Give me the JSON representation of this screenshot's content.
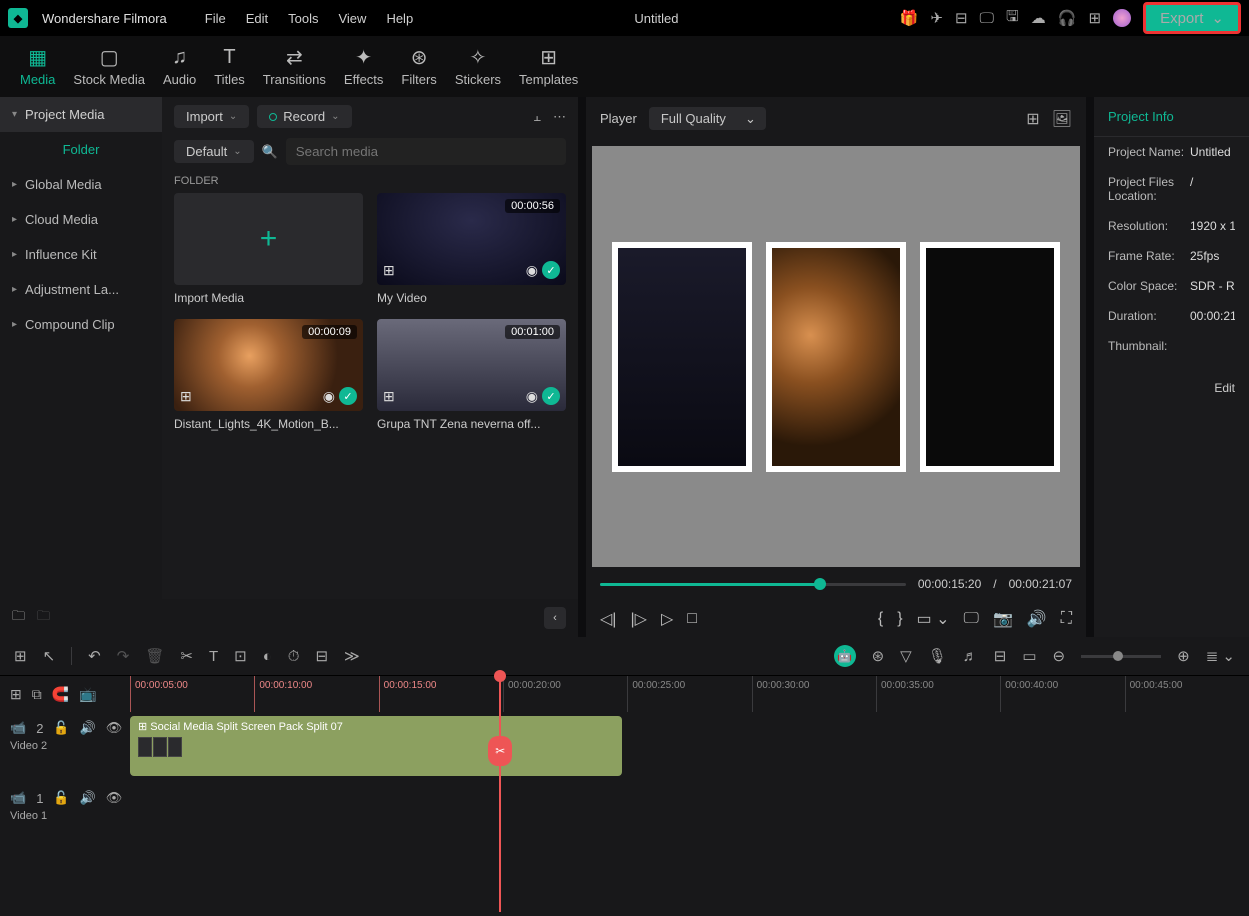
{
  "app": {
    "name": "Wondershare Filmora",
    "doc": "Untitled"
  },
  "menu": [
    "File",
    "Edit",
    "Tools",
    "View",
    "Help"
  ],
  "export": "Export",
  "topTabs": [
    {
      "label": "Media",
      "icon": "▦"
    },
    {
      "label": "Stock Media",
      "icon": "▢"
    },
    {
      "label": "Audio",
      "icon": "♫"
    },
    {
      "label": "Titles",
      "icon": "T"
    },
    {
      "label": "Transitions",
      "icon": "⇄"
    },
    {
      "label": "Effects",
      "icon": "✦"
    },
    {
      "label": "Filters",
      "icon": "⊛"
    },
    {
      "label": "Stickers",
      "icon": "✧"
    },
    {
      "label": "Templates",
      "icon": "⊞"
    }
  ],
  "sideNav": {
    "header": "Project Media",
    "folder": "Folder",
    "items": [
      "Global Media",
      "Cloud Media",
      "Influence Kit",
      "Adjustment La...",
      "Compound Clip"
    ]
  },
  "mediaToolbar": {
    "import": "Import",
    "record": "Record",
    "sort": "Default",
    "searchPlaceholder": "Search media"
  },
  "folderLabel": "FOLDER",
  "mediaItems": [
    {
      "name": "Import Media",
      "dur": "",
      "import": true
    },
    {
      "name": "My Video",
      "dur": "00:00:56"
    },
    {
      "name": "Distant_Lights_4K_Motion_B...",
      "dur": "00:00:09"
    },
    {
      "name": "Grupa TNT Zena neverna off...",
      "dur": "00:01:00"
    }
  ],
  "preview": {
    "label": "Player",
    "quality": "Full Quality",
    "current": "00:00:15:20",
    "sep": "/",
    "total": "00:00:21:07"
  },
  "info": {
    "header": "Project Info",
    "rows": [
      {
        "label": "Project Name:",
        "value": "Untitled"
      },
      {
        "label": "Project Files Location:",
        "value": "/"
      },
      {
        "label": "Resolution:",
        "value": "1920 x 1"
      },
      {
        "label": "Frame Rate:",
        "value": "25fps"
      },
      {
        "label": "Color Space:",
        "value": "SDR - Re"
      },
      {
        "label": "Duration:",
        "value": "00:00:21"
      },
      {
        "label": "Thumbnail:",
        "value": ""
      }
    ],
    "edit": "Edit"
  },
  "ruler": [
    "00:00:05:00",
    "00:00:10:00",
    "00:00:15:00",
    "00:00:20:00",
    "00:00:25:00",
    "00:00:30:00",
    "00:00:35:00",
    "00:00:40:00",
    "00:00:45:00"
  ],
  "clip": {
    "name": "Social Media Split Screen Pack Split 07"
  },
  "tracks": [
    {
      "name": "Video 2",
      "num": "2"
    },
    {
      "name": "Video 1",
      "num": "1"
    }
  ]
}
